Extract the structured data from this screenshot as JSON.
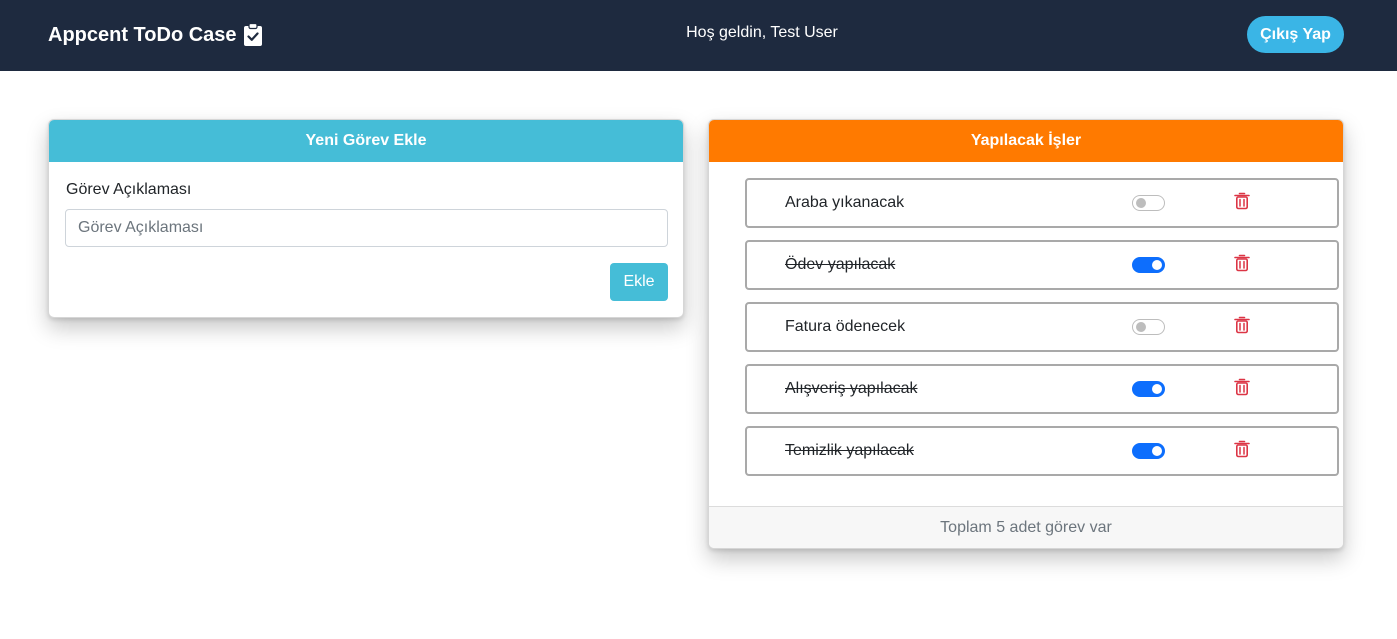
{
  "navbar": {
    "brand": "Appcent ToDo Case",
    "brand_icon": "clipboard-check-icon",
    "welcome": "Hoş geldin, Test User",
    "logout_label": "Çıkış Yap"
  },
  "add_card": {
    "title": "Yeni Görev Ekle",
    "field_label": "Görev Açıklaması",
    "input_placeholder": "Görev Açıklaması",
    "input_value": "",
    "add_label": "Ekle"
  },
  "list_card": {
    "title": "Yapılacak İşler",
    "items": [
      {
        "text": "Araba yıkanacak",
        "completed": false
      },
      {
        "text": "Ödev yapılacak",
        "completed": true
      },
      {
        "text": "Fatura ödenecek",
        "completed": false
      },
      {
        "text": "Alışveriş yapılacak",
        "completed": true
      },
      {
        "text": "Temizlik yapılacak",
        "completed": true
      }
    ],
    "footer": "Toplam 5 adet görev var"
  },
  "colors": {
    "navbar_bg": "#1e2a3f",
    "add_header": "#45bdd7",
    "list_header": "#ff7a00",
    "toggle_on": "#0d6efd",
    "trash": "#dc3545",
    "logout_bg": "#3ab5e6"
  }
}
